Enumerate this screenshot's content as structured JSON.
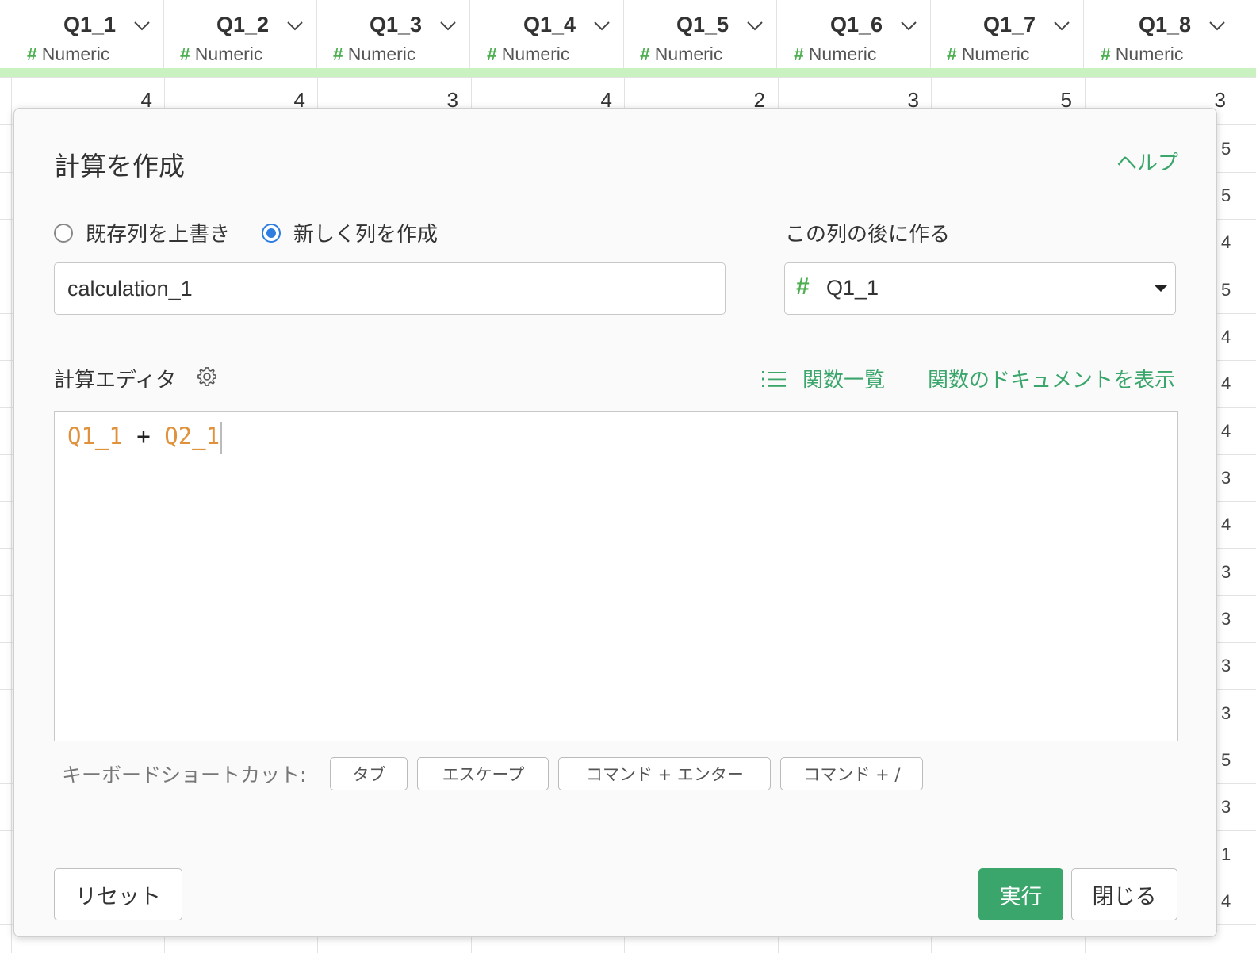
{
  "grid": {
    "columns": [
      {
        "name": "Q1_1",
        "type": "Numeric",
        "first_value": "4"
      },
      {
        "name": "Q1_2",
        "type": "Numeric",
        "first_value": "4"
      },
      {
        "name": "Q1_3",
        "type": "Numeric",
        "first_value": "3"
      },
      {
        "name": "Q1_4",
        "type": "Numeric",
        "first_value": "4"
      },
      {
        "name": "Q1_5",
        "type": "Numeric",
        "first_value": "2"
      },
      {
        "name": "Q1_6",
        "type": "Numeric",
        "first_value": "3"
      },
      {
        "name": "Q1_7",
        "type": "Numeric",
        "first_value": "5"
      },
      {
        "name": "Q1_8",
        "type": "Numeric",
        "first_value": "3"
      }
    ],
    "type_icon": "#",
    "right_edge_values": [
      "5",
      "5",
      "4",
      "5",
      "4",
      "4",
      "4",
      "3",
      "4",
      "3",
      "3",
      "3",
      "3",
      "5",
      "3",
      "1",
      "4"
    ]
  },
  "modal": {
    "title": "計算を作成",
    "help": "ヘルプ",
    "radio_overwrite": "既存列を上書き",
    "radio_new": "新しく列を作成",
    "selected_radio": "new",
    "after_column_label": "この列の後に作る",
    "new_column_name": "calculation_1",
    "after_column": {
      "icon": "#",
      "value": "Q1_1"
    },
    "editor_label": "計算エディタ",
    "function_list": "関数一覧",
    "function_docs": "関数のドキュメントを表示",
    "code": {
      "col1": "Q1_1",
      "op": " + ",
      "col2": "Q2_1"
    },
    "shortcut_label": "キーボードショートカット:",
    "shortcuts": [
      "タブ",
      "エスケープ",
      "コマンド + エンター",
      "コマンド + /"
    ],
    "reset_button": "リセット",
    "run_button": "実行",
    "close_button": "閉じる"
  },
  "colors": {
    "accent_green": "#3aa66b",
    "type_green": "#4caf50",
    "radio_blue": "#2f7de1",
    "code_column": "#e0913b",
    "header_bar": "#c9f2c0"
  },
  "icons": {
    "column_menu": "chevron-down-icon",
    "editor_settings": "gear-icon",
    "function_list": "list-icon",
    "select_caret": "caret-down-icon"
  }
}
